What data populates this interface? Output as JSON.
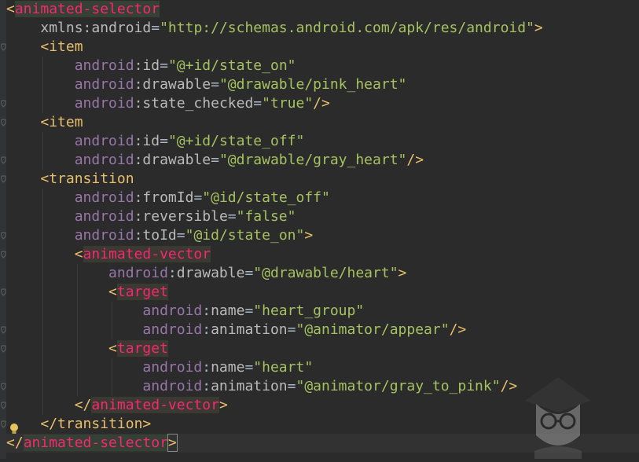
{
  "code_lines": [
    {
      "indent": 0,
      "tokens": [
        [
          "bracket",
          "<"
        ],
        [
          "tag sel",
          "animated-selector"
        ]
      ]
    },
    {
      "indent": 1,
      "tokens": [
        [
          "attr",
          "xmlns"
        ],
        [
          "eq",
          ":"
        ],
        [
          "attr",
          "android"
        ],
        [
          "eq",
          "="
        ],
        [
          "val",
          "\"http://schemas.android.com/apk/res/android\""
        ],
        [
          "bracket",
          ">"
        ]
      ]
    },
    {
      "indent": 1,
      "tokens": [
        [
          "bracket",
          "<"
        ],
        [
          "tag",
          "item"
        ]
      ]
    },
    {
      "indent": 2,
      "tokens": [
        [
          "ns",
          "android"
        ],
        [
          "eq",
          ":"
        ],
        [
          "attr",
          "id"
        ],
        [
          "eq",
          "="
        ],
        [
          "val",
          "\"@+id/state_on\""
        ]
      ]
    },
    {
      "indent": 2,
      "tokens": [
        [
          "ns",
          "android"
        ],
        [
          "eq",
          ":"
        ],
        [
          "attr",
          "drawable"
        ],
        [
          "eq",
          "="
        ],
        [
          "val",
          "\"@drawable/pink_heart\""
        ]
      ]
    },
    {
      "indent": 2,
      "tokens": [
        [
          "ns",
          "android"
        ],
        [
          "eq",
          ":"
        ],
        [
          "attr",
          "state_checked"
        ],
        [
          "eq",
          "="
        ],
        [
          "val",
          "\"true\""
        ],
        [
          "bracket",
          "/>"
        ]
      ]
    },
    {
      "indent": 1,
      "tokens": [
        [
          "bracket",
          "<"
        ],
        [
          "tag",
          "item"
        ]
      ]
    },
    {
      "indent": 2,
      "tokens": [
        [
          "ns",
          "android"
        ],
        [
          "eq",
          ":"
        ],
        [
          "attr",
          "id"
        ],
        [
          "eq",
          "="
        ],
        [
          "val",
          "\"@+id/state_off\""
        ]
      ]
    },
    {
      "indent": 2,
      "tokens": [
        [
          "ns",
          "android"
        ],
        [
          "eq",
          ":"
        ],
        [
          "attr",
          "drawable"
        ],
        [
          "eq",
          "="
        ],
        [
          "val",
          "\"@drawable/gray_heart\""
        ],
        [
          "bracket",
          "/>"
        ]
      ]
    },
    {
      "indent": 1,
      "tokens": [
        [
          "bracket",
          "<"
        ],
        [
          "tag",
          "transition"
        ]
      ]
    },
    {
      "indent": 2,
      "tokens": [
        [
          "ns",
          "android"
        ],
        [
          "eq",
          ":"
        ],
        [
          "attr",
          "fromId"
        ],
        [
          "eq",
          "="
        ],
        [
          "val",
          "\"@id/state_off\""
        ]
      ]
    },
    {
      "indent": 2,
      "tokens": [
        [
          "ns",
          "android"
        ],
        [
          "eq",
          ":"
        ],
        [
          "attr",
          "reversible"
        ],
        [
          "eq",
          "="
        ],
        [
          "val",
          "\"false\""
        ]
      ]
    },
    {
      "indent": 2,
      "tokens": [
        [
          "ns",
          "android"
        ],
        [
          "eq",
          ":"
        ],
        [
          "attr",
          "toId"
        ],
        [
          "eq",
          "="
        ],
        [
          "val",
          "\"@id/state_on\""
        ],
        [
          "bracket",
          ">"
        ]
      ]
    },
    {
      "indent": 2,
      "tokens": [
        [
          "bracket",
          "<"
        ],
        [
          "tag hl",
          "animated-vector"
        ]
      ]
    },
    {
      "indent": 3,
      "tokens": [
        [
          "ns",
          "android"
        ],
        [
          "eq",
          ":"
        ],
        [
          "attr",
          "drawable"
        ],
        [
          "eq",
          "="
        ],
        [
          "val",
          "\"@drawable/heart\""
        ],
        [
          "bracket",
          ">"
        ]
      ]
    },
    {
      "indent": 3,
      "tokens": [
        [
          "bracket",
          "<"
        ],
        [
          "tag hl",
          "target"
        ]
      ]
    },
    {
      "indent": 4,
      "tokens": [
        [
          "ns",
          "android"
        ],
        [
          "eq",
          ":"
        ],
        [
          "attr",
          "name"
        ],
        [
          "eq",
          "="
        ],
        [
          "val",
          "\"heart_group\""
        ]
      ]
    },
    {
      "indent": 4,
      "tokens": [
        [
          "ns",
          "android"
        ],
        [
          "eq",
          ":"
        ],
        [
          "attr",
          "animation"
        ],
        [
          "eq",
          "="
        ],
        [
          "val",
          "\"@animator/appear\""
        ],
        [
          "bracket",
          "/>"
        ]
      ]
    },
    {
      "indent": 3,
      "tokens": [
        [
          "bracket",
          "<"
        ],
        [
          "tag hl",
          "target"
        ]
      ]
    },
    {
      "indent": 4,
      "tokens": [
        [
          "ns",
          "android"
        ],
        [
          "eq",
          ":"
        ],
        [
          "attr",
          "name"
        ],
        [
          "eq",
          "="
        ],
        [
          "val",
          "\"heart\""
        ]
      ]
    },
    {
      "indent": 4,
      "tokens": [
        [
          "ns",
          "android"
        ],
        [
          "eq",
          ":"
        ],
        [
          "attr",
          "animation"
        ],
        [
          "eq",
          "="
        ],
        [
          "val",
          "\"@animator/gray_to_pink\""
        ],
        [
          "bracket",
          "/>"
        ]
      ]
    },
    {
      "indent": 2,
      "tokens": [
        [
          "bracket",
          "</"
        ],
        [
          "tag hl",
          "animated-vector"
        ],
        [
          "bracket",
          ">"
        ]
      ]
    },
    {
      "indent": 1,
      "tokens": [
        [
          "bracket",
          "</"
        ],
        [
          "tag",
          "transition"
        ],
        [
          "bracket",
          ">"
        ]
      ]
    },
    {
      "indent": 0,
      "tokens": [
        [
          "bracket",
          "</"
        ],
        [
          "tag sel",
          "animated-selector"
        ],
        [
          "bracket-sel",
          ">"
        ]
      ]
    }
  ],
  "colors": {
    "background": "#2b2b2b",
    "tag": "#e8bf6a",
    "tag_highlight": "#f92672",
    "namespace": "#9876aa",
    "attribute": "#bababa",
    "string_value": "#a5c261"
  },
  "icons": {
    "intention": "lightbulb-icon",
    "fold": "fold-marker-icon",
    "watermark": "avatar-watermark"
  }
}
